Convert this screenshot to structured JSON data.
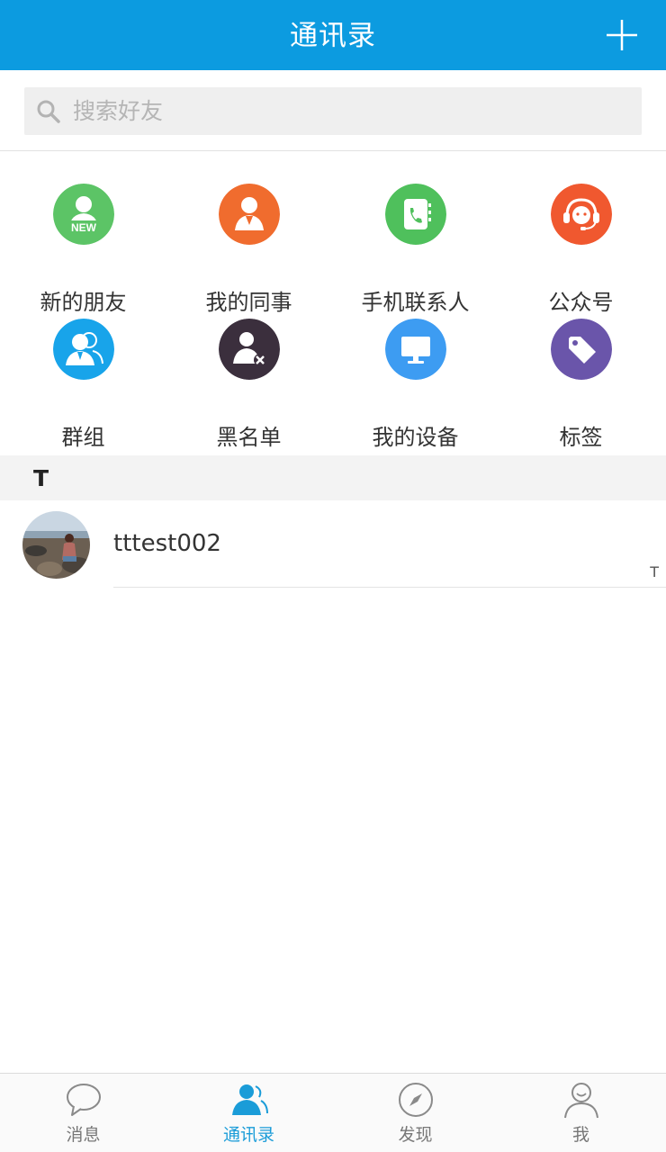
{
  "header": {
    "title": "通讯录",
    "add_icon": "plus-icon"
  },
  "search": {
    "placeholder": "搜索好友",
    "icon": "search-icon"
  },
  "shortcuts": [
    {
      "label": "新的朋友",
      "icon": "new-friend-icon",
      "color": "#5cc466"
    },
    {
      "label": "我的同事",
      "icon": "colleague-icon",
      "color": "#f06c2e"
    },
    {
      "label": "手机联系人",
      "icon": "phone-contacts-icon",
      "color": "#4fc05c"
    },
    {
      "label": "公众号",
      "icon": "headset-icon",
      "color": "#f0582f"
    },
    {
      "label": "群组",
      "icon": "group-icon",
      "color": "#18a4ea"
    },
    {
      "label": "黑名单",
      "icon": "blacklist-icon",
      "color": "#3b2f3d"
    },
    {
      "label": "我的设备",
      "icon": "monitor-icon",
      "color": "#3d9cf2"
    },
    {
      "label": "标签",
      "icon": "tag-icon",
      "color": "#6a55aa"
    }
  ],
  "contacts": {
    "section_letter": "T",
    "items": [
      {
        "name": "tttest002"
      }
    ]
  },
  "index_bar": {
    "letters": [
      "T"
    ]
  },
  "tabbar": {
    "active": "通讯录",
    "accent": "#1a9cd8",
    "tabs": [
      {
        "label": "消息",
        "icon": "chat-bubble-icon"
      },
      {
        "label": "通讯录",
        "icon": "contacts-icon"
      },
      {
        "label": "发现",
        "icon": "compass-icon"
      },
      {
        "label": "我",
        "icon": "person-icon"
      }
    ]
  }
}
